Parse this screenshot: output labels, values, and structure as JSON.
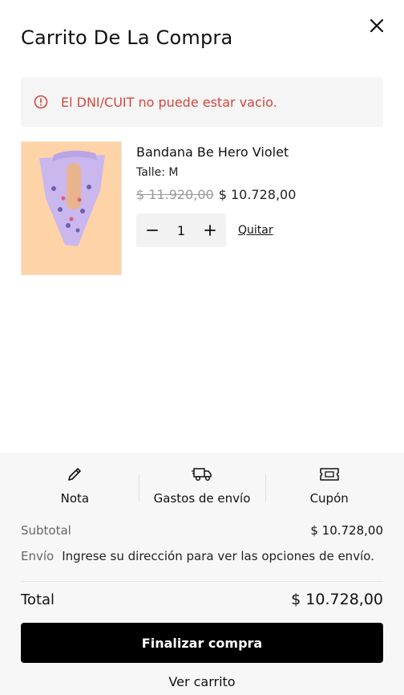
{
  "header": {
    "title": "Carrito De La Compra",
    "close_icon": "close-icon"
  },
  "alert": {
    "icon": "alert-circle-icon",
    "message": "El DNI/CUIT no puede estar vacio.",
    "color": "#d6453d"
  },
  "cart": {
    "items": [
      {
        "name": "Bandana Be Hero Violet",
        "variant": "Talle: M",
        "price_original": "$ 11.920,00",
        "price_current": "$ 10.728,00",
        "quantity": "1",
        "remove_label": "Quitar"
      }
    ]
  },
  "footer": {
    "actions": [
      {
        "label": "Nota",
        "icon": "pencil-icon"
      },
      {
        "label": "Gastos de envío",
        "icon": "truck-icon"
      },
      {
        "label": "Cupón",
        "icon": "ticket-icon"
      }
    ],
    "subtotal_label": "Subtotal",
    "subtotal_value": "$ 10.728,00",
    "shipping_label": "Envío",
    "shipping_value": "Ingrese su dirección para ver las opciones de envío.",
    "total_label": "Total",
    "total_value": "$ 10.728,00",
    "checkout_label": "Finalizar compra",
    "view_cart_label": "Ver carrito"
  }
}
